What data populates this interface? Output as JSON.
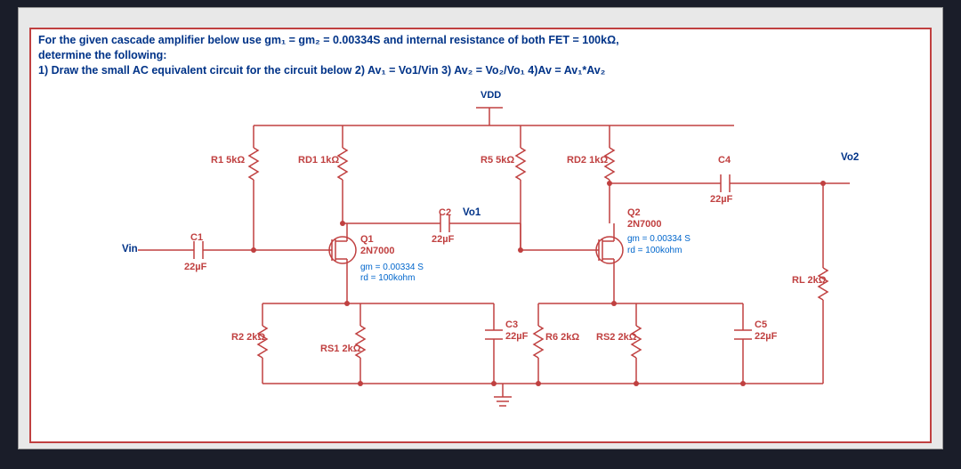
{
  "question": {
    "line1": "For the given cascade amplifier below use gm₁ = gm₂ = 0.00334S and internal resistance of both FET = 100kΩ,",
    "line2": "determine the following:",
    "line3": "1)  Draw the small AC equivalent circuit for the circuit below  2) Av₁ = Vo1/Vin  3) Av₂ = Vo₂/Vo₁  4)Av = Av₁*Av₂"
  },
  "rails": {
    "vdd": "VDD"
  },
  "nodes": {
    "vin": "Vin",
    "vo1": "Vo1",
    "vo2": "Vo2"
  },
  "components": {
    "R1": {
      "ref": "R1",
      "val": "5kΩ"
    },
    "RD1": {
      "ref": "RD1",
      "val": "1kΩ"
    },
    "R5": {
      "ref": "R5",
      "val": "5kΩ"
    },
    "RD2": {
      "ref": "RD2",
      "val": "1kΩ"
    },
    "C4": {
      "ref": "C4",
      "val": "22µF"
    },
    "C1": {
      "ref": "C1",
      "val": "22µF"
    },
    "C2": {
      "ref": "C2",
      "val": "22µF"
    },
    "Q1": {
      "ref": "Q1",
      "type": "2N7000",
      "gm": "gm = 0.00334 S",
      "rd": "rd = 100kohm"
    },
    "Q2": {
      "ref": "Q2",
      "type": "2N7000",
      "gm": "gm = 0.00334 S",
      "rd": "rd = 100kohm"
    },
    "R2": {
      "ref": "R2",
      "val": "2kΩ"
    },
    "RS1": {
      "ref": "RS1",
      "val": "2kΩ"
    },
    "C3": {
      "ref": "C3",
      "val": "22µF"
    },
    "R6": {
      "ref": "R6",
      "val": "2kΩ"
    },
    "RS2": {
      "ref": "RS2",
      "val": "2kΩ"
    },
    "C5": {
      "ref": "C5",
      "val": "22µF"
    },
    "RL": {
      "ref": "RL",
      "val": "2kΩ"
    }
  }
}
